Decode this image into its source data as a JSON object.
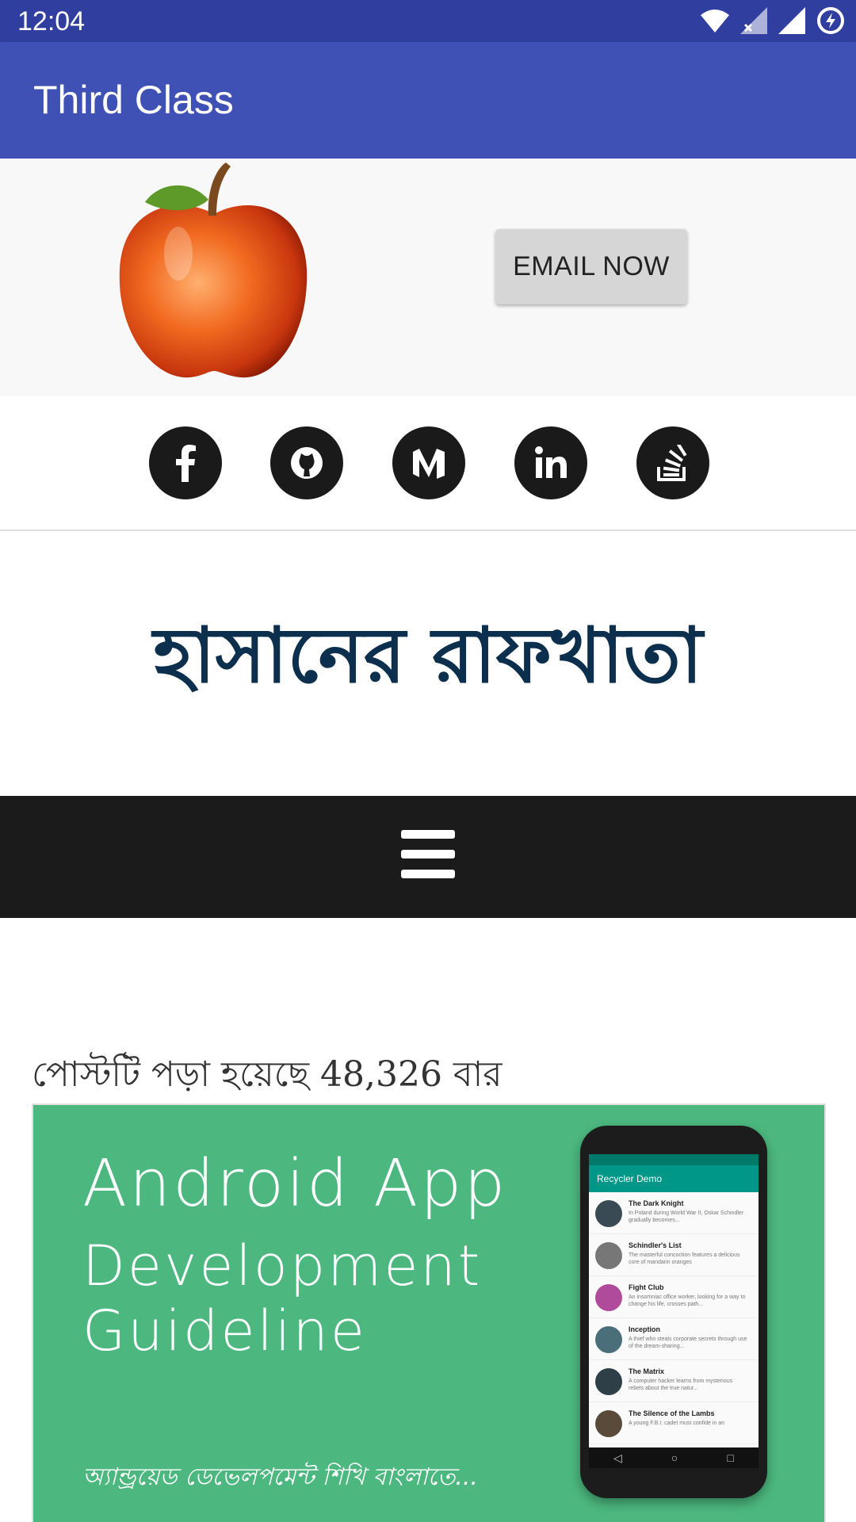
{
  "status_bar": {
    "time": "12:04"
  },
  "app_bar": {
    "title": "Third Class"
  },
  "actions": {
    "email_button": "EMAIL NOW"
  },
  "social_links": [
    "facebook",
    "github",
    "medium",
    "linkedin",
    "stackoverflow"
  ],
  "blog": {
    "logo_text": "হাসানের রাফখাতা",
    "view_count_text": "পোস্টটি পড়া হয়েছে 48,326 বার"
  },
  "banner": {
    "title_line1": "Android App",
    "title_line2": "Development",
    "title_line3": "Guideline",
    "tagline": "অ্যান্ড্রয়েড ডেভেলপমেন্ট শিখি বাংলাতে...",
    "phone_app_title": "Recycler Demo",
    "movies": [
      {
        "title": "The Dark Knight",
        "desc": "In Poland during World War II, Oskar Schindler gradually becomes..."
      },
      {
        "title": "Schindler's List",
        "desc": "The masterful concoction features a delicious core of mandarin oranges"
      },
      {
        "title": "Fight Club",
        "desc": "An insomniac office worker, looking for a way to change his life, crosses path..."
      },
      {
        "title": "Inception",
        "desc": "A thief who steals corporate secrets through use of the dream-sharing..."
      },
      {
        "title": "The Matrix",
        "desc": "A computer hacker learns from mysterious rebels about the true natur..."
      },
      {
        "title": "The Silence of the Lambs",
        "desc": "A young F.B.I. cadet must confide in an"
      }
    ]
  },
  "colors": {
    "primary": "#3F51B5",
    "primary_dark": "#303F9F",
    "banner_green": "#4CB87F",
    "nav_dark": "#1B1B1B"
  }
}
